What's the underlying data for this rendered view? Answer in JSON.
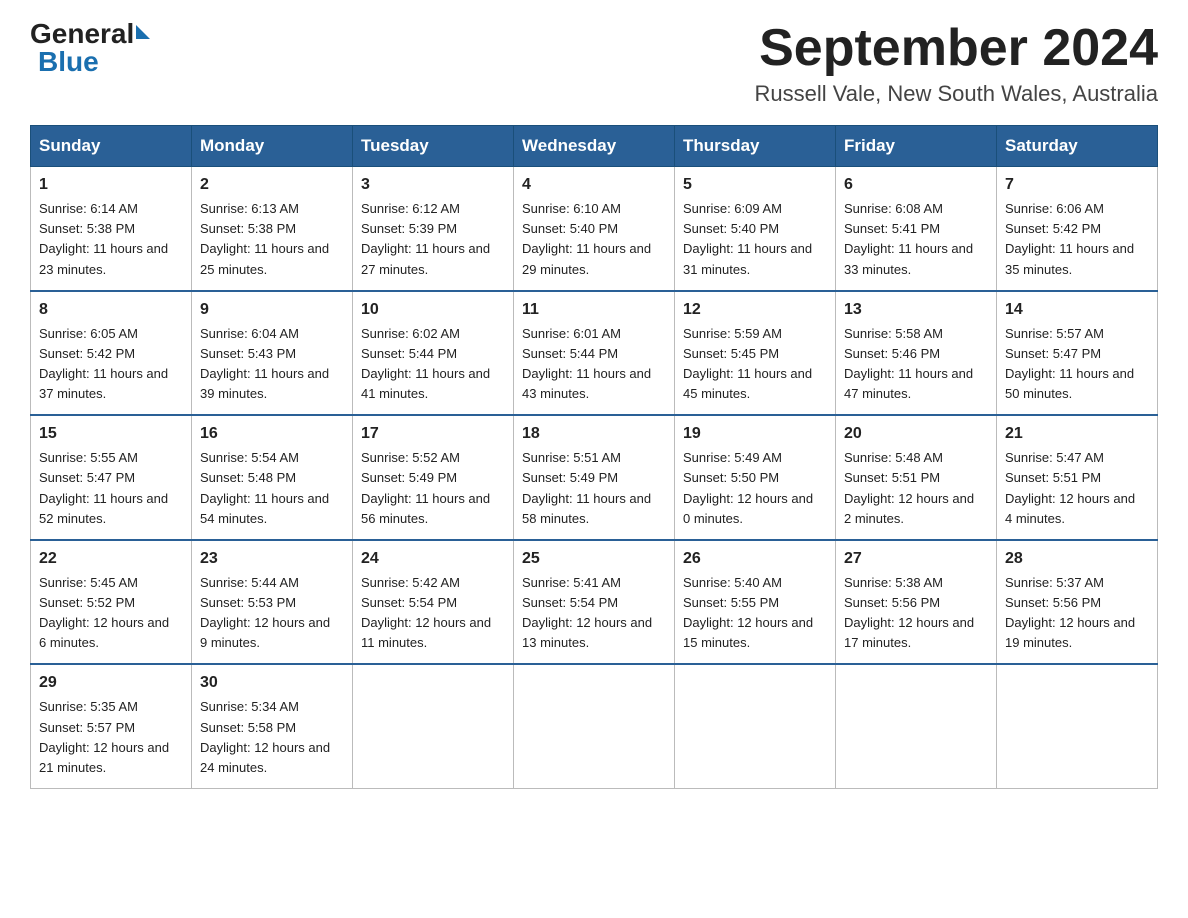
{
  "header": {
    "logo_general": "General",
    "logo_blue": "Blue",
    "title": "September 2024",
    "subtitle": "Russell Vale, New South Wales, Australia"
  },
  "days_of_week": [
    "Sunday",
    "Monday",
    "Tuesday",
    "Wednesday",
    "Thursday",
    "Friday",
    "Saturday"
  ],
  "weeks": [
    [
      {
        "num": "1",
        "sunrise": "6:14 AM",
        "sunset": "5:38 PM",
        "daylight": "11 hours and 23 minutes."
      },
      {
        "num": "2",
        "sunrise": "6:13 AM",
        "sunset": "5:38 PM",
        "daylight": "11 hours and 25 minutes."
      },
      {
        "num": "3",
        "sunrise": "6:12 AM",
        "sunset": "5:39 PM",
        "daylight": "11 hours and 27 minutes."
      },
      {
        "num": "4",
        "sunrise": "6:10 AM",
        "sunset": "5:40 PM",
        "daylight": "11 hours and 29 minutes."
      },
      {
        "num": "5",
        "sunrise": "6:09 AM",
        "sunset": "5:40 PM",
        "daylight": "11 hours and 31 minutes."
      },
      {
        "num": "6",
        "sunrise": "6:08 AM",
        "sunset": "5:41 PM",
        "daylight": "11 hours and 33 minutes."
      },
      {
        "num": "7",
        "sunrise": "6:06 AM",
        "sunset": "5:42 PM",
        "daylight": "11 hours and 35 minutes."
      }
    ],
    [
      {
        "num": "8",
        "sunrise": "6:05 AM",
        "sunset": "5:42 PM",
        "daylight": "11 hours and 37 minutes."
      },
      {
        "num": "9",
        "sunrise": "6:04 AM",
        "sunset": "5:43 PM",
        "daylight": "11 hours and 39 minutes."
      },
      {
        "num": "10",
        "sunrise": "6:02 AM",
        "sunset": "5:44 PM",
        "daylight": "11 hours and 41 minutes."
      },
      {
        "num": "11",
        "sunrise": "6:01 AM",
        "sunset": "5:44 PM",
        "daylight": "11 hours and 43 minutes."
      },
      {
        "num": "12",
        "sunrise": "5:59 AM",
        "sunset": "5:45 PM",
        "daylight": "11 hours and 45 minutes."
      },
      {
        "num": "13",
        "sunrise": "5:58 AM",
        "sunset": "5:46 PM",
        "daylight": "11 hours and 47 minutes."
      },
      {
        "num": "14",
        "sunrise": "5:57 AM",
        "sunset": "5:47 PM",
        "daylight": "11 hours and 50 minutes."
      }
    ],
    [
      {
        "num": "15",
        "sunrise": "5:55 AM",
        "sunset": "5:47 PM",
        "daylight": "11 hours and 52 minutes."
      },
      {
        "num": "16",
        "sunrise": "5:54 AM",
        "sunset": "5:48 PM",
        "daylight": "11 hours and 54 minutes."
      },
      {
        "num": "17",
        "sunrise": "5:52 AM",
        "sunset": "5:49 PM",
        "daylight": "11 hours and 56 minutes."
      },
      {
        "num": "18",
        "sunrise": "5:51 AM",
        "sunset": "5:49 PM",
        "daylight": "11 hours and 58 minutes."
      },
      {
        "num": "19",
        "sunrise": "5:49 AM",
        "sunset": "5:50 PM",
        "daylight": "12 hours and 0 minutes."
      },
      {
        "num": "20",
        "sunrise": "5:48 AM",
        "sunset": "5:51 PM",
        "daylight": "12 hours and 2 minutes."
      },
      {
        "num": "21",
        "sunrise": "5:47 AM",
        "sunset": "5:51 PM",
        "daylight": "12 hours and 4 minutes."
      }
    ],
    [
      {
        "num": "22",
        "sunrise": "5:45 AM",
        "sunset": "5:52 PM",
        "daylight": "12 hours and 6 minutes."
      },
      {
        "num": "23",
        "sunrise": "5:44 AM",
        "sunset": "5:53 PM",
        "daylight": "12 hours and 9 minutes."
      },
      {
        "num": "24",
        "sunrise": "5:42 AM",
        "sunset": "5:54 PM",
        "daylight": "12 hours and 11 minutes."
      },
      {
        "num": "25",
        "sunrise": "5:41 AM",
        "sunset": "5:54 PM",
        "daylight": "12 hours and 13 minutes."
      },
      {
        "num": "26",
        "sunrise": "5:40 AM",
        "sunset": "5:55 PM",
        "daylight": "12 hours and 15 minutes."
      },
      {
        "num": "27",
        "sunrise": "5:38 AM",
        "sunset": "5:56 PM",
        "daylight": "12 hours and 17 minutes."
      },
      {
        "num": "28",
        "sunrise": "5:37 AM",
        "sunset": "5:56 PM",
        "daylight": "12 hours and 19 minutes."
      }
    ],
    [
      {
        "num": "29",
        "sunrise": "5:35 AM",
        "sunset": "5:57 PM",
        "daylight": "12 hours and 21 minutes."
      },
      {
        "num": "30",
        "sunrise": "5:34 AM",
        "sunset": "5:58 PM",
        "daylight": "12 hours and 24 minutes."
      },
      null,
      null,
      null,
      null,
      null
    ]
  ],
  "labels": {
    "sunrise": "Sunrise:",
    "sunset": "Sunset:",
    "daylight": "Daylight:"
  }
}
